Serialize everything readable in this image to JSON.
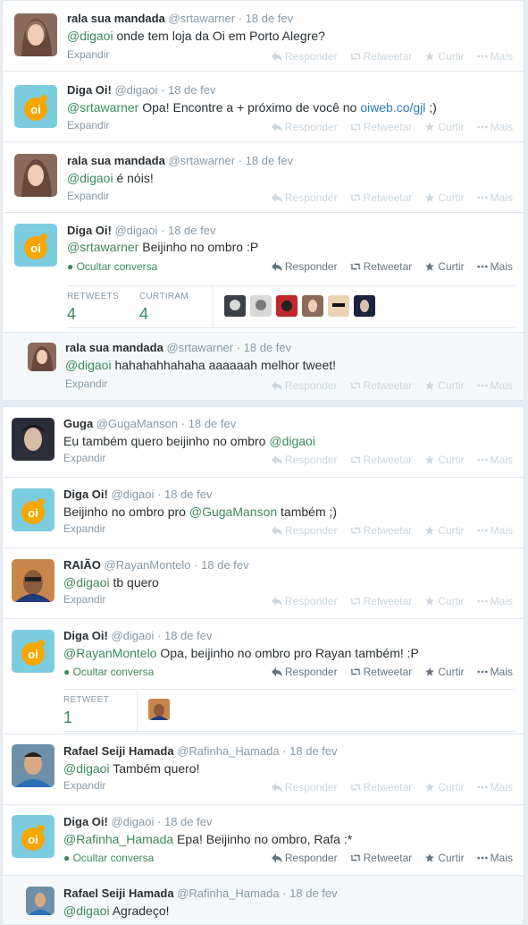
{
  "actions": {
    "reply": "Responder",
    "retweet": "Retweetar",
    "fav": "Curtir",
    "more": "Mais"
  },
  "labels": {
    "expand": "Expandir",
    "hide": "Ocultar conversa",
    "retweets": "RETWEETS",
    "favs": "CURTIRAM",
    "retweet_single": "RETWEET"
  },
  "colors": {
    "link": "#2b7bb9",
    "mention": "#3a8a5e",
    "oi": "#f5a700"
  },
  "tweets": [
    {
      "name": "rala sua mandada",
      "handle": "@srtawarner",
      "time": "18 de fev",
      "mention": "@digaoi",
      "text": " onde tem loja da Oi em Porto Alegre?"
    },
    {
      "name": "Diga Oi!",
      "handle": "@digaoi",
      "time": "18 de fev",
      "mention": "@srtawarner",
      "text": " Opa! Encontre a + próximo de você no ",
      "link": "oiweb.co/gjl",
      "text2": " ;)"
    },
    {
      "name": "rala sua mandada",
      "handle": "@srtawarner",
      "time": "18 de fev",
      "mention": "@digaoi",
      "text": " é nóis!"
    },
    {
      "name": "Diga Oi!",
      "handle": "@digaoi",
      "time": "18 de fev",
      "mention": "@srtawarner",
      "text": " Beijinho no ombro :P",
      "retweets": "4",
      "favs": "4"
    },
    {
      "name": "rala sua mandada",
      "handle": "@srtawarner",
      "time": "18 de fev",
      "mention": "@digaoi",
      "text": " hahahahhahaha aaaaaah melhor tweet!"
    },
    {
      "name": "Guga",
      "handle": "@GugaManson",
      "time": "18 de fev",
      "text": "Eu também quero beijinho no ombro ",
      "mention": "@digaoi"
    },
    {
      "name": "Diga Oi!",
      "handle": "@digaoi",
      "time": "18 de fev",
      "text": "Beijinho no ombro pro ",
      "mention": "@GugaManson",
      "text2": " também ;)"
    },
    {
      "name": "RAIÃO",
      "handle": "@RayanMontelo",
      "time": "18 de fev",
      "mention": "@digaoi",
      "text": " tb quero"
    },
    {
      "name": "Diga Oi!",
      "handle": "@digaoi",
      "time": "18 de fev",
      "mention": "@RayanMontelo",
      "text": " Opa, beijinho no ombro pro Rayan também! :P",
      "retweets": "1"
    },
    {
      "name": "Rafael Seiji Hamada",
      "handle": "@Rafinha_Hamada",
      "time": "18 de fev",
      "mention": "@digaoi",
      "text": " Também quero!"
    },
    {
      "name": "Diga Oi!",
      "handle": "@digaoi",
      "time": "18 de fev",
      "mention": "@Rafinha_Hamada",
      "text": " Epa! Beijinho no ombro, Rafa :*"
    },
    {
      "name": "Rafael Seiji Hamada",
      "handle": "@Rafinha_Hamada",
      "time": "18 de fev",
      "mention": "@digaoi",
      "text": " Agradeço!"
    }
  ]
}
